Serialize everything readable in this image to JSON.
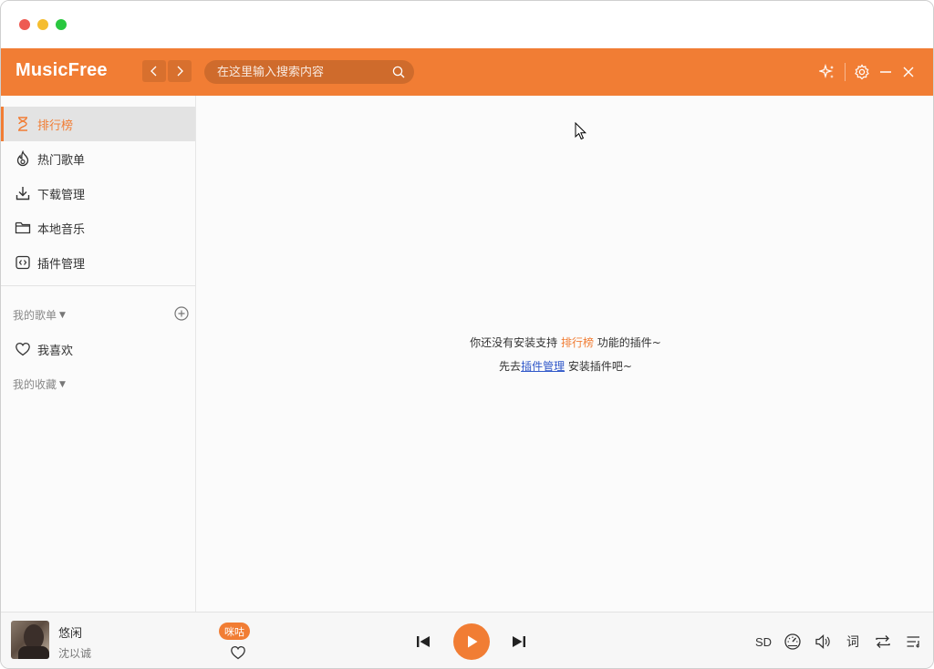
{
  "header": {
    "logo": "MusicFree",
    "search_placeholder": "在这里输入搜索内容"
  },
  "sidebar": {
    "items": [
      {
        "label": "排行榜",
        "icon": "hourglass-icon",
        "active": true
      },
      {
        "label": "热门歌单",
        "icon": "fire-icon"
      },
      {
        "label": "下载管理",
        "icon": "download-icon"
      },
      {
        "label": "本地音乐",
        "icon": "folder-icon"
      },
      {
        "label": "插件管理",
        "icon": "plugin-icon"
      }
    ],
    "my_playlists_title": "我的歌单",
    "favorite_label": "我喜欢",
    "my_collection_title": "我的收藏"
  },
  "main": {
    "empty_prefix": "你还没有安装支持 ",
    "empty_highlight": "排行榜",
    "empty_suffix": " 功能的插件~",
    "hint_prefix": "先去",
    "hint_link": "插件管理",
    "hint_suffix": " 安装插件吧~"
  },
  "player": {
    "song_title": "悠闲",
    "artist": "沈以诚",
    "source": "咪咕",
    "quality": "SD",
    "lyric_label": "词"
  },
  "colors": {
    "accent": "#f17d34",
    "link": "#2f57c9"
  }
}
